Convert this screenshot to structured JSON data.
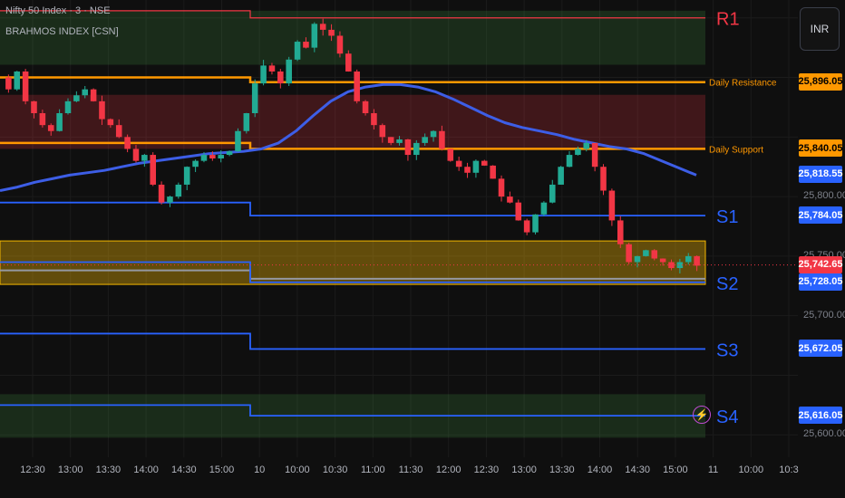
{
  "legend": {
    "symbol_title": "Nifty 50 Index · 3 · NSE",
    "indicator_name": "BRAHMOS INDEX [CSN]"
  },
  "currency_label": "INR",
  "colors": {
    "background": "#0f0f0f",
    "bull": "#22ab94",
    "bear": "#f23645",
    "resistance_line": "#ff9800",
    "sma_line": "#3d5ee6",
    "support_line": "#2962ff",
    "pivot_gray": "#9598a1"
  },
  "chart_data": {
    "type": "line",
    "title": "Nifty 50 Index · 3 · NSE",
    "ylim": [
      25585,
      25965
    ],
    "x_tick_labels": [
      "12:30",
      "13:00",
      "13:30",
      "14:00",
      "14:30",
      "15:00",
      "10",
      "10:00",
      "10:30",
      "11:00",
      "11:30",
      "12:00",
      "12:30",
      "13:00",
      "13:30",
      "14:00",
      "14:30",
      "15:00",
      "11",
      "10:00",
      "10:3"
    ],
    "session_boundaries_ticks": [
      "10",
      "11"
    ],
    "levels": [
      {
        "name": "R1",
        "label": "R1",
        "day1": 25956,
        "day2": 25950,
        "band": "green-top"
      },
      {
        "name": "Daily Resistance",
        "label": "Daily Resistance",
        "day1": 25900,
        "day2": 25896.05
      },
      {
        "name": "Daily Support",
        "label": "Daily Support",
        "day1": 25845,
        "day2": 25840.05
      },
      {
        "name": "S1",
        "label": "S1",
        "day1": 25795,
        "day2": 25784.05
      },
      {
        "name": "Pivot",
        "label": "",
        "day1": 25738,
        "day2": 25731
      },
      {
        "name": "S2",
        "label": "S2",
        "day1": 25745,
        "day2": 25728.05
      },
      {
        "name": "S3",
        "label": "S3",
        "day1": 25685,
        "day2": 25672.05
      },
      {
        "name": "S4",
        "label": "S4",
        "day1": 25625,
        "day2": 25616.05
      }
    ],
    "price_tags": [
      {
        "text": "25,896.05",
        "value": 25896.05,
        "color": "#ff9800",
        "text_color": "#000000"
      },
      {
        "text": "25,840.05",
        "value": 25840.05,
        "color": "#ff9800",
        "text_color": "#000000"
      },
      {
        "text": "25,818.55",
        "value": 25818.55,
        "color": "#2962ff",
        "text_color": "#ffffff"
      },
      {
        "text": "25,784.05",
        "value": 25784.05,
        "color": "#2962ff",
        "text_color": "#ffffff"
      },
      {
        "text": "25,742.65",
        "value": 25742.65,
        "color": "#f23645",
        "text_color": "#ffffff"
      },
      {
        "text": "25,728.05",
        "value": 25728.05,
        "color": "#2962ff",
        "text_color": "#ffffff"
      },
      {
        "text": "25,672.05",
        "value": 25672.05,
        "color": "#2962ff",
        "text_color": "#ffffff"
      },
      {
        "text": "25,616.05",
        "value": 25616.05,
        "color": "#2962ff",
        "text_color": "#ffffff"
      }
    ],
    "scale_labels": [
      "25,800.00",
      "25,750.00",
      "25,700.00",
      "25,600.00"
    ],
    "close_path": [
      25900,
      25890,
      25905,
      25880,
      25870,
      25860,
      25855,
      25870,
      25880,
      25885,
      25890,
      25880,
      25865,
      25860,
      25850,
      25840,
      25830,
      25835,
      25810,
      25795,
      25800,
      25810,
      25825,
      25830,
      25835,
      25832,
      25835,
      25838,
      25855,
      25870,
      25895,
      25910,
      25905,
      25895,
      25915,
      25930,
      25925,
      25945,
      25940,
      25935,
      25920,
      25905,
      25880,
      25870,
      25860,
      25850,
      25845,
      25848,
      25835,
      25845,
      25850,
      25855,
      25840,
      25830,
      25825,
      25820,
      25830,
      25826,
      25815,
      25800,
      25795,
      25780,
      25770,
      25785,
      25795,
      25810,
      25825,
      25835,
      25840,
      25845,
      25825,
      25805,
      25780,
      25760,
      25745,
      25750,
      25755,
      25748,
      25745,
      25740,
      25745,
      25750,
      25742
    ],
    "sma_path": [
      25805,
      25808,
      25812,
      25815,
      25818,
      25820,
      25822,
      25825,
      25828,
      25830,
      25832,
      25834,
      25836,
      25837,
      25838,
      25840,
      25845,
      25855,
      25868,
      25880,
      25888,
      25892,
      25894,
      25894,
      25892,
      25888,
      25882,
      25875,
      25868,
      25862,
      25858,
      25855,
      25852,
      25848,
      25845,
      25842,
      25840,
      25836,
      25830,
      25824,
      25818
    ]
  }
}
